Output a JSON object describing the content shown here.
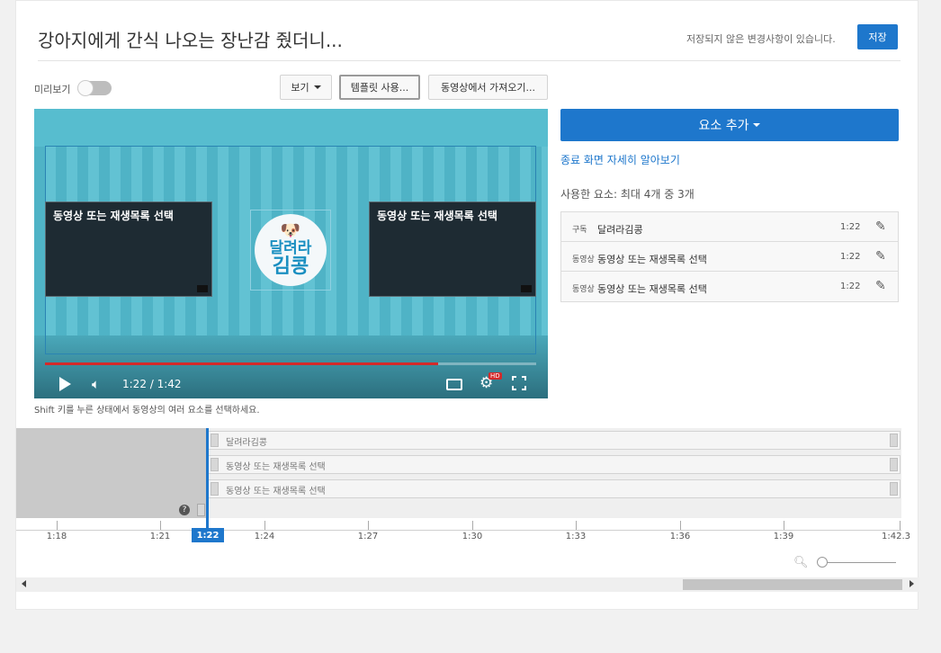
{
  "header": {
    "title": "강아지에게 간식 나오는 장난감 줬더니...",
    "unsaved_text": "저장되지 않은 변경사항이 있습니다.",
    "save_label": "저장"
  },
  "toolbar": {
    "preview_label": "미리보기",
    "preview_on": false,
    "view_label": "보기",
    "template_label": "템플릿 사용...",
    "import_label": "동영상에서 가져오기..."
  },
  "video": {
    "tile_left_label": "동영상 또는 재생목록 선택",
    "tile_right_label": "동영상 또는 재생목록 선택",
    "logo_line1": "달려라",
    "logo_line2": "김콩",
    "time_display": "1:22 / 1:42",
    "hd_badge": "HD",
    "progress_fraction": 0.8
  },
  "hint": "Shift 키를 누른 상태에서 동영상의 여러 요소를 선택하세요.",
  "panel": {
    "add_element_label": "요소 추가",
    "learn_more_link": "종료 화면 자세히 알아보기",
    "used_text": "사용한 요소: 최대 4개 중 3개",
    "elements": [
      {
        "type": "구독",
        "name": "달려라김콩",
        "time": "1:22"
      },
      {
        "type": "동영상",
        "name": "동영상 또는 재생목록 선택",
        "time": "1:22"
      },
      {
        "type": "동영상",
        "name": "동영상 또는 재생목록 선택",
        "time": "1:22"
      }
    ]
  },
  "timeline": {
    "tracks": [
      "달려라김콩",
      "동영상 또는 재생목록 선택",
      "동영상 또는 재생목록 선택"
    ],
    "help_icon": "?",
    "playhead_label": "1:22",
    "ticks": [
      "1:18",
      "1:21",
      "1:24",
      "1:27",
      "1:30",
      "1:33",
      "1:36",
      "1:39",
      "1:42.3"
    ]
  },
  "colors": {
    "accent": "#1e77cc",
    "progress_red": "#d42a2a"
  }
}
